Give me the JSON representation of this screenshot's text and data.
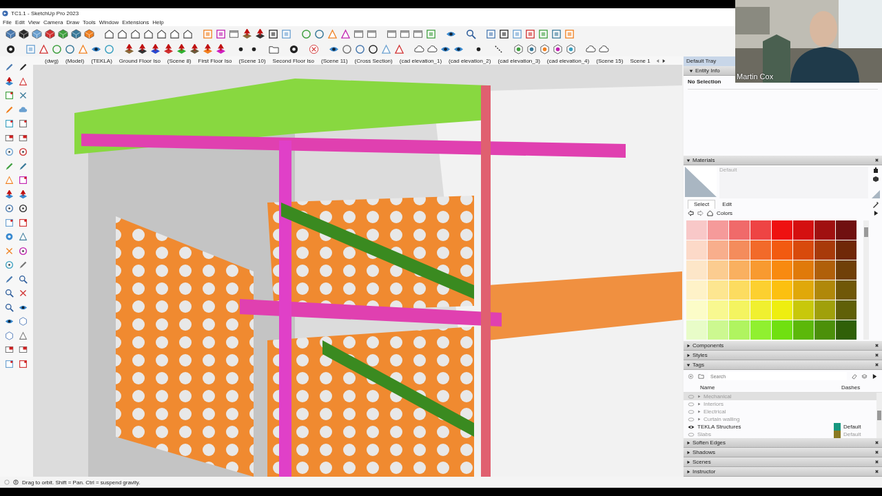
{
  "window": {
    "title": "TC1.1 - SketchUp Pro 2023"
  },
  "menu": [
    "File",
    "Edit",
    "View",
    "Camera",
    "Draw",
    "Tools",
    "Window",
    "Extensions",
    "Help"
  ],
  "scene_tabs": [
    {
      "label": "(dwg)",
      "selected": false
    },
    {
      "label": "(Model)",
      "selected": false
    },
    {
      "label": "(TEKLA)",
      "selected": false
    },
    {
      "label": "Ground Floor Iso",
      "selected": false
    },
    {
      "label": "(Scene 8)",
      "selected": false
    },
    {
      "label": "First Floor Iso",
      "selected": false
    },
    {
      "label": "(Scene 10)",
      "selected": false
    },
    {
      "label": "Second Floor Iso",
      "selected": false
    },
    {
      "label": "(Scene 11)",
      "selected": false
    },
    {
      "label": "(Cross Section)",
      "selected": false
    },
    {
      "label": "(cad elevation_1)",
      "selected": false
    },
    {
      "label": "(cad elevation_2)",
      "selected": false
    },
    {
      "label": "(cad elevation_3)",
      "selected": false
    },
    {
      "label": "(cad elevation_4)",
      "selected": false
    },
    {
      "label": "(Scene 15)",
      "selected": false
    },
    {
      "label": "Scene 1",
      "selected": false
    }
  ],
  "tray": {
    "title": "Default Tray",
    "panels": [
      {
        "kind": "entity",
        "title": "Entity Info",
        "expanded": true,
        "selection": "No Selection"
      },
      {
        "kind": "materials",
        "title": "Materials",
        "expanded": true,
        "material": "Default",
        "tabs": [
          {
            "label": "Select",
            "selected": true
          },
          {
            "label": "Edit",
            "selected": false
          }
        ],
        "library": "Colors",
        "swatches": [
          {
            "color": "#f8c8c8"
          },
          {
            "color": "#f59a9a"
          },
          {
            "color": "#f06a6a"
          },
          {
            "color": "#ee4444"
          },
          {
            "color": "#ee1111"
          },
          {
            "color": "#d41010"
          },
          {
            "color": "#a01010"
          },
          {
            "color": "#701010"
          },
          {
            "color": "#fcd9c8"
          },
          {
            "color": "#f8ae8c"
          },
          {
            "color": "#f48c5c"
          },
          {
            "color": "#f26a2a"
          },
          {
            "color": "#f25a10"
          },
          {
            "color": "#d84a0c"
          },
          {
            "color": "#a83a0a"
          },
          {
            "color": "#702808"
          },
          {
            "color": "#fde6c8"
          },
          {
            "color": "#fbcc90"
          },
          {
            "color": "#f9b060"
          },
          {
            "color": "#f89a30"
          },
          {
            "color": "#f88a10"
          },
          {
            "color": "#e07a0a"
          },
          {
            "color": "#b0600a"
          },
          {
            "color": "#704008"
          },
          {
            "color": "#fef2c8"
          },
          {
            "color": "#fde690"
          },
          {
            "color": "#fcdc60"
          },
          {
            "color": "#fcd030"
          },
          {
            "color": "#fcc010"
          },
          {
            "color": "#e0a80a"
          },
          {
            "color": "#b0880a"
          },
          {
            "color": "#705808"
          },
          {
            "color": "#fcfcc8"
          },
          {
            "color": "#f8f890"
          },
          {
            "color": "#f4f460"
          },
          {
            "color": "#f0f030"
          },
          {
            "color": "#eeee10"
          },
          {
            "color": "#c8c80a"
          },
          {
            "color": "#a0a00a"
          },
          {
            "color": "#606008"
          },
          {
            "color": "#e8fcc8"
          },
          {
            "color": "#ccf890"
          },
          {
            "color": "#b0f460"
          },
          {
            "color": "#90f030"
          },
          {
            "color": "#70e010"
          },
          {
            "color": "#5cb80a"
          },
          {
            "color": "#4c900a"
          },
          {
            "color": "#306008"
          }
        ]
      },
      {
        "kind": "plain",
        "title": "Components",
        "expanded": false
      },
      {
        "kind": "plain",
        "title": "Styles",
        "expanded": false
      },
      {
        "kind": "tags",
        "title": "Tags",
        "expanded": true,
        "search": {
          "placeholder": "Search"
        },
        "columns": [
          "Name",
          "Dashes"
        ],
        "rows": [
          {
            "kind": "folder",
            "name": "Mechanical",
            "visible": false,
            "selected": true
          },
          {
            "kind": "folder",
            "name": "Interiors",
            "visible": false,
            "selected": false
          },
          {
            "kind": "folder",
            "name": "Electrical",
            "visible": false,
            "selected": false
          },
          {
            "kind": "folder",
            "name": "Curtain walling",
            "visible": false,
            "selected": false
          },
          {
            "kind": "tag",
            "name": "TEKLA Structures",
            "visible": true,
            "selected": false,
            "color": "#17977f",
            "dashes": "Default"
          },
          {
            "kind": "tag",
            "name": "Slabs",
            "visible": false,
            "selected": false,
            "color": "#8a7a22",
            "dashes": "Default"
          }
        ]
      },
      {
        "kind": "plain",
        "title": "Soften Edges",
        "expanded": false
      },
      {
        "kind": "plain",
        "title": "Shadows",
        "expanded": false
      },
      {
        "kind": "plain",
        "title": "Scenes",
        "expanded": false
      },
      {
        "kind": "plain",
        "title": "Instructor",
        "expanded": false
      }
    ]
  },
  "status_bar": {
    "text": "Drag to orbit. Shift = Pan. Ctrl = suspend gravity."
  },
  "webcam": {
    "name": "Martin Cox"
  }
}
